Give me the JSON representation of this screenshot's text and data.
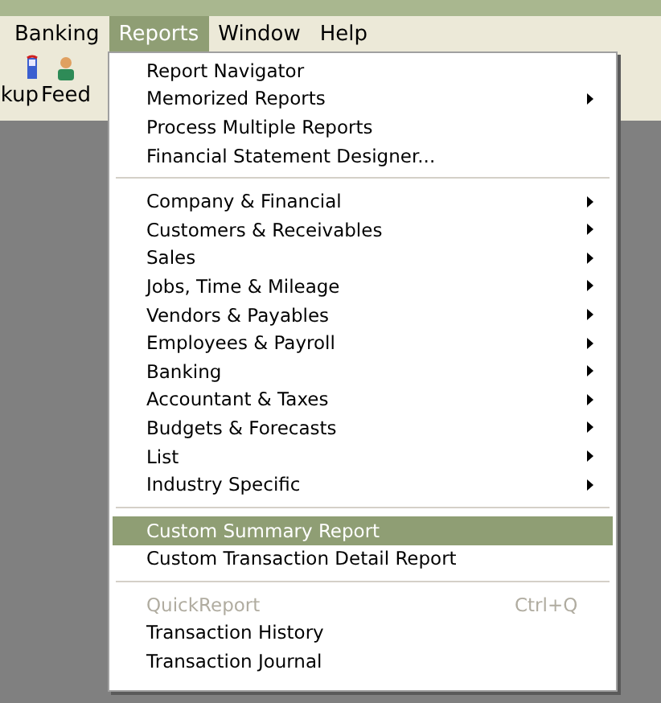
{
  "menubar": [
    {
      "label": "Banking",
      "selected": false
    },
    {
      "label": "Reports",
      "selected": true
    },
    {
      "label": "Window",
      "selected": false
    },
    {
      "label": "Help",
      "selected": false
    }
  ],
  "toolbar": [
    {
      "label": "kup",
      "kind": "backup"
    },
    {
      "label": "Feed",
      "kind": "person"
    }
  ],
  "menu": {
    "sections": [
      {
        "items": [
          {
            "label": "Report Navigator",
            "submenu": false,
            "selected": false,
            "disabled": false
          },
          {
            "label": "Memorized Reports",
            "submenu": true,
            "selected": false,
            "disabled": false
          },
          {
            "label": "Process Multiple Reports",
            "submenu": false,
            "selected": false,
            "disabled": false
          },
          {
            "label": "Financial Statement Designer...",
            "submenu": false,
            "selected": false,
            "disabled": false
          }
        ]
      },
      {
        "items": [
          {
            "label": "Company & Financial",
            "submenu": true,
            "selected": false,
            "disabled": false
          },
          {
            "label": "Customers & Receivables",
            "submenu": true,
            "selected": false,
            "disabled": false
          },
          {
            "label": "Sales",
            "submenu": true,
            "selected": false,
            "disabled": false
          },
          {
            "label": "Jobs, Time & Mileage",
            "submenu": true,
            "selected": false,
            "disabled": false
          },
          {
            "label": "Vendors & Payables",
            "submenu": true,
            "selected": false,
            "disabled": false
          },
          {
            "label": "Employees & Payroll",
            "submenu": true,
            "selected": false,
            "disabled": false
          },
          {
            "label": "Banking",
            "submenu": true,
            "selected": false,
            "disabled": false
          },
          {
            "label": "Accountant & Taxes",
            "submenu": true,
            "selected": false,
            "disabled": false
          },
          {
            "label": "Budgets & Forecasts",
            "submenu": true,
            "selected": false,
            "disabled": false
          },
          {
            "label": "List",
            "submenu": true,
            "selected": false,
            "disabled": false
          },
          {
            "label": "Industry Specific",
            "submenu": true,
            "selected": false,
            "disabled": false
          }
        ]
      },
      {
        "items": [
          {
            "label": "Custom Summary Report",
            "submenu": false,
            "selected": true,
            "disabled": false
          },
          {
            "label": "Custom Transaction Detail Report",
            "submenu": false,
            "selected": false,
            "disabled": false
          }
        ]
      },
      {
        "items": [
          {
            "label": "QuickReport",
            "shortcut": "Ctrl+Q",
            "submenu": false,
            "selected": false,
            "disabled": true
          },
          {
            "label": "Transaction History",
            "submenu": false,
            "selected": false,
            "disabled": false
          },
          {
            "label": "Transaction Journal",
            "submenu": false,
            "selected": false,
            "disabled": false
          }
        ]
      }
    ]
  }
}
